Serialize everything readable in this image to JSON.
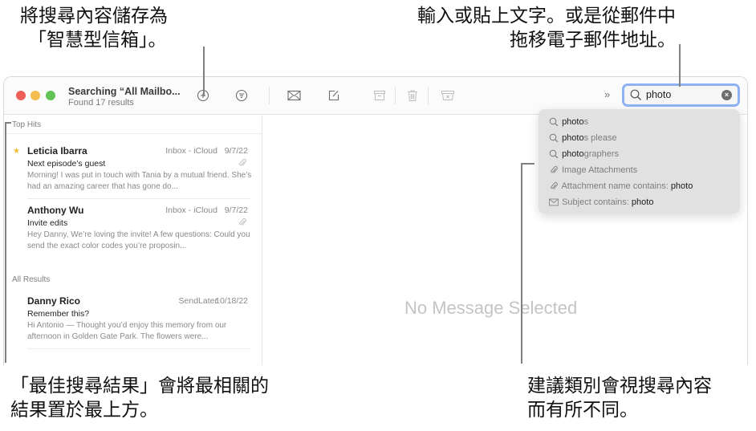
{
  "callouts": {
    "top_left": [
      "將搜尋內容儲存為",
      "「智慧型信箱」。"
    ],
    "top_right": [
      "輸入或貼上文字。或是從郵件中",
      "拖移電子郵件地址。"
    ],
    "bottom_left": [
      "「最佳搜尋結果」會將最相關的",
      "結果置於最上方。"
    ],
    "bottom_right": [
      "建議類別會視搜尋內容",
      "而有所不同。"
    ]
  },
  "window": {
    "title": "Searching “All Mailbo...",
    "subtitle": "Found 17 results",
    "traffic_lights": {
      "close": "#ee5f57",
      "minimize": "#f3bd4f",
      "zoom": "#61c454"
    }
  },
  "toolbar": {
    "icons": [
      "add-smart-mailbox-icon",
      "filter-icon",
      "get-mail-icon",
      "compose-icon",
      "archive-icon",
      "trash-icon",
      "junk-icon",
      "overflow-chevron-icon"
    ],
    "overflow_label": "»"
  },
  "search": {
    "value": "photo",
    "accent": "#8fb2f5"
  },
  "suggestions": [
    {
      "icon": "search-icon",
      "bold": "photo",
      "rest": "s",
      "type": "prefix"
    },
    {
      "icon": "search-icon",
      "bold": "photo",
      "rest": "s please",
      "type": "prefix"
    },
    {
      "icon": "search-icon",
      "bold": "photo",
      "rest": "graphers",
      "type": "prefix"
    },
    {
      "icon": "paperclip-icon",
      "label": "Image Attachments",
      "value": "",
      "type": "label"
    },
    {
      "icon": "paperclip-icon",
      "label": "Attachment name contains: ",
      "value": "photo",
      "type": "label"
    },
    {
      "icon": "envelope-icon",
      "label": "Subject contains: ",
      "value": "photo",
      "type": "label"
    }
  ],
  "list": {
    "top_hits_label": "Top Hits",
    "all_results_label": "All Results",
    "messages": [
      {
        "sender": "Leticia Ibarra",
        "mailbox": "Inbox - iCloud",
        "date": "9/7/22",
        "subject": "Next episode’s guest",
        "preview": "Morning! I was put in touch with Tania by a mutual friend. She’s had an amazing career that has gone do...",
        "flagged": true,
        "attachment": true
      },
      {
        "sender": "Anthony Wu",
        "mailbox": "Inbox - iCloud",
        "date": "9/7/22",
        "subject": "Invite edits",
        "preview": "Hey Danny, We’re loving the invite! A few questions: Could you send the exact color codes you’re proposin...",
        "flagged": false,
        "attachment": true
      },
      {
        "sender": "Danny Rico",
        "mailbox": "SendLater",
        "date": "10/18/22",
        "subject": "Remember this?",
        "preview": "Hi Antonio — Thought you’d enjoy this memory from our afternoon in Golden Gate Park. The flowers were...",
        "flagged": false,
        "attachment": false
      }
    ]
  },
  "detail": {
    "empty_label": "No Message Selected"
  }
}
